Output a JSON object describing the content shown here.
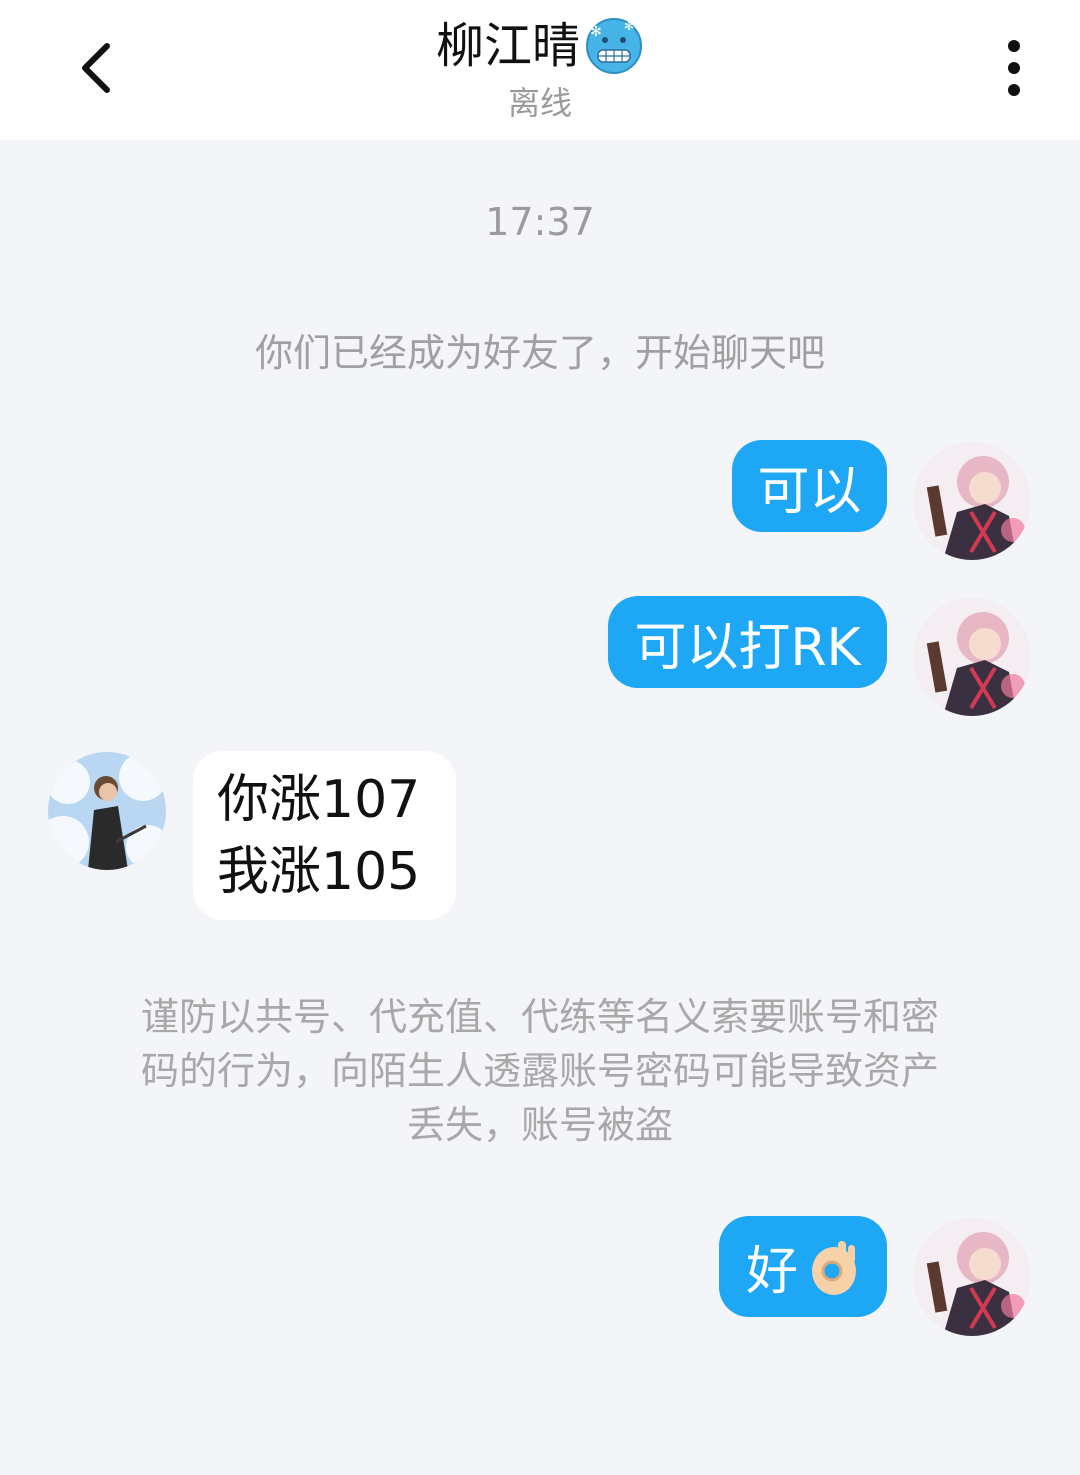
{
  "header": {
    "contact_name": "柳江晴",
    "name_emoji_icon": "cold-face-emoji-icon",
    "status": "离线",
    "back_icon": "chevron-left-icon",
    "more_icon": "more-vertical-icon"
  },
  "chat": {
    "timestamp": "17:37",
    "friend_notice": "你们已经成为好友了，开始聊天吧",
    "messages": [
      {
        "direction": "out",
        "text": "可以"
      },
      {
        "direction": "out",
        "text": "可以打RK"
      },
      {
        "direction": "in",
        "lines": [
          "你涨107",
          "我涨105"
        ]
      },
      {
        "direction": "out",
        "text": "好",
        "emoji_icon": "ok-hand-emoji-icon"
      }
    ],
    "security_warning_lines": [
      "谨防以共号、代充值、代练等名义索要账号和密",
      "码的行为，向陌生人透露账号密码可能导致资产",
      "丢失，账号被盗"
    ]
  },
  "colors": {
    "outgoing_bubble": "#1ea7f5",
    "incoming_bubble": "#ffffff",
    "background": "#f3f5f9"
  }
}
